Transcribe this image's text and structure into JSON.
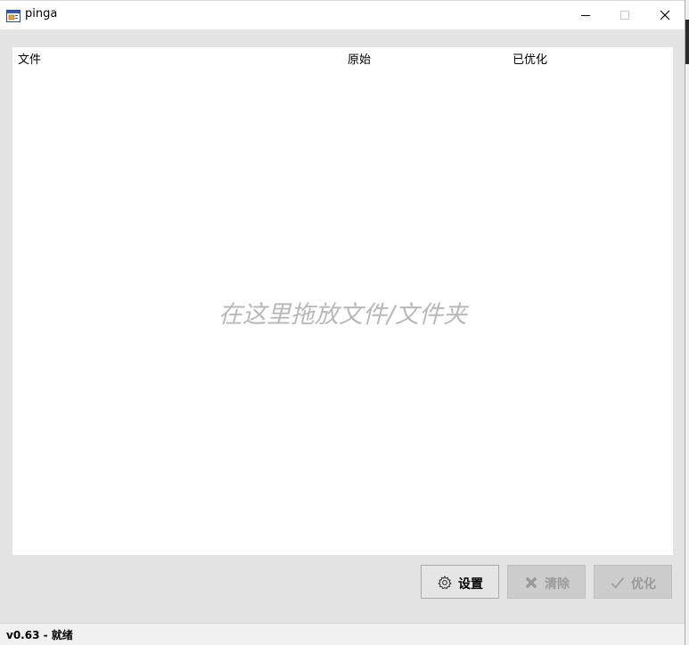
{
  "window": {
    "title": "pinga",
    "app_icon": "pinga-app-icon",
    "controls": [
      "minimize-icon",
      "maximize-icon",
      "close-icon"
    ]
  },
  "file_list": {
    "columns": [
      "文件",
      "原始",
      "已优化"
    ],
    "drop_hint": "在这里拖放文件/文件夹"
  },
  "buttons": {
    "settings": {
      "label": "设置",
      "icon": "gear-icon",
      "enabled": true
    },
    "clear": {
      "label": "清除",
      "icon": "x-icon",
      "enabled": false
    },
    "optimize": {
      "label": "优化",
      "icon": "checkmark-icon",
      "enabled": false
    }
  },
  "status": {
    "text": "v0.63 - 就绪"
  },
  "colors": {
    "background": "#e3e3e3",
    "list_background": "#ffffff",
    "hint_text": "#b8b8b8",
    "disabled_text": "#9a9a9a"
  }
}
